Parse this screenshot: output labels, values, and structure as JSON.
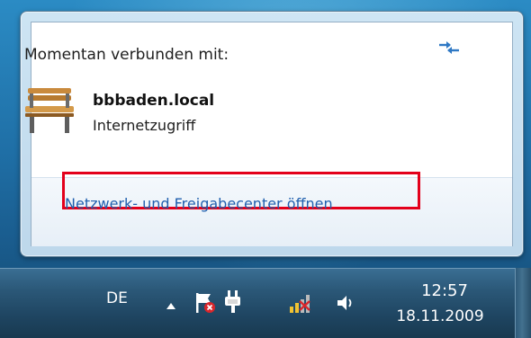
{
  "flyout": {
    "heading": "Momentan verbunden mit:",
    "network": {
      "name": "bbbaden.local",
      "status": "Internetzugriff"
    },
    "link_label": "Netzwerk- und Freigabecenter öffnen"
  },
  "taskbar": {
    "language": "DE",
    "clock": {
      "time": "12:57",
      "date": "18.11.2009"
    }
  },
  "icons": {
    "refresh": "refresh-arrows-icon",
    "network_type": "bench-network-icon",
    "tray": [
      "show-hidden-icons-arrow",
      "action-center-flag-icon",
      "power-plug-icon",
      "network-signal-icon",
      "volume-speaker-icon"
    ]
  },
  "colors": {
    "link": "#1f5fae",
    "highlight_box": "#e3001b",
    "taskbar": "#1e4460"
  }
}
